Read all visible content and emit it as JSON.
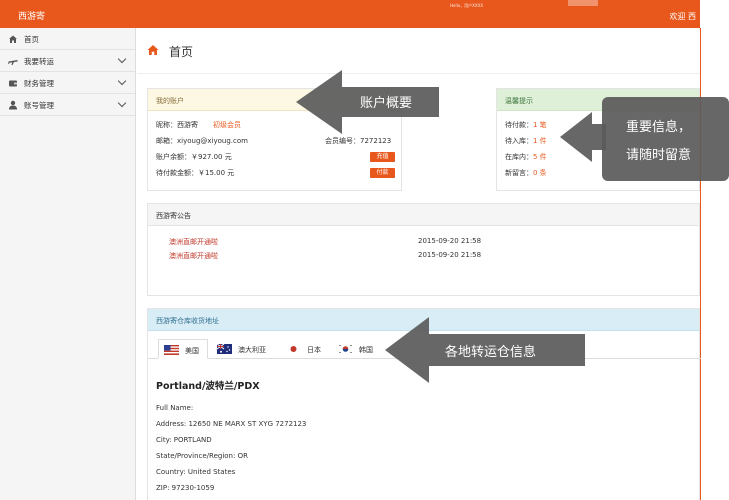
{
  "topbar": {
    "brand": "西游寄",
    "welcome": "欢迎 西",
    "smudge": "Hello，用户XXXX"
  },
  "sidebar": {
    "items": [
      {
        "label": "首页",
        "icon": "home-icon",
        "has_chevron": false
      },
      {
        "label": "我要转运",
        "icon": "airplane-icon",
        "has_chevron": true
      },
      {
        "label": "财务管理",
        "icon": "wallet-icon",
        "has_chevron": true
      },
      {
        "label": "账号管理",
        "icon": "user-icon",
        "has_chevron": true
      }
    ]
  },
  "page": {
    "title": "首页",
    "title_icon": "home-icon"
  },
  "account": {
    "heading": "我的账户",
    "nickname_label": "昵称：西游寄",
    "member_level": "初级会员",
    "email_label": "邮箱：xiyoug@xiyoug.com",
    "member_no": "会员编号：7272123",
    "balance": "账户余额：￥927.00 元",
    "recharge_btn": "充值",
    "pending": "待付款金额：￥15.00 元",
    "pay_btn": "付款"
  },
  "reminder": {
    "heading": "温馨提示",
    "rows": [
      {
        "label": "待付款：",
        "value": "1 笔"
      },
      {
        "label": "待入库：",
        "value": "1 件"
      },
      {
        "label": "在库内：",
        "value": "5 件"
      },
      {
        "label": "新留言：",
        "value": "0 条"
      }
    ]
  },
  "notice": {
    "heading": "西游寄公告",
    "items": [
      {
        "title": "澳洲直邮开通啦",
        "date": "2015-09-20 21:58"
      },
      {
        "title": "澳洲直邮开通啦",
        "date": "2015-09-20 21:58"
      }
    ]
  },
  "warehouse": {
    "heading": "西游寄仓库收货地址",
    "tabs": [
      {
        "label": "美国",
        "icon": "us-flag-icon",
        "active": true
      },
      {
        "label": "澳大利亚",
        "icon": "australia-flag-icon",
        "active": false
      },
      {
        "label": "日本",
        "icon": "japan-flag-icon",
        "active": false
      },
      {
        "label": "韩国",
        "icon": "korea-flag-icon",
        "active": false
      }
    ],
    "title": "Portland/波特兰/PDX",
    "lines": [
      "Full Name:",
      "Address: 12650 NE MARX ST XYG 7272123",
      "City: PORTLAND",
      "State/Province/Region: OR",
      "Country: United States",
      "ZIP: 97230-1059"
    ]
  },
  "callouts": [
    {
      "text": "账户概要"
    },
    {
      "line1": "重要信息，",
      "line2": "请随时留意"
    },
    {
      "text": "各地转运仓信息"
    }
  ],
  "colors": {
    "brand": "#e8581d",
    "callout": "#5a5a5a"
  }
}
